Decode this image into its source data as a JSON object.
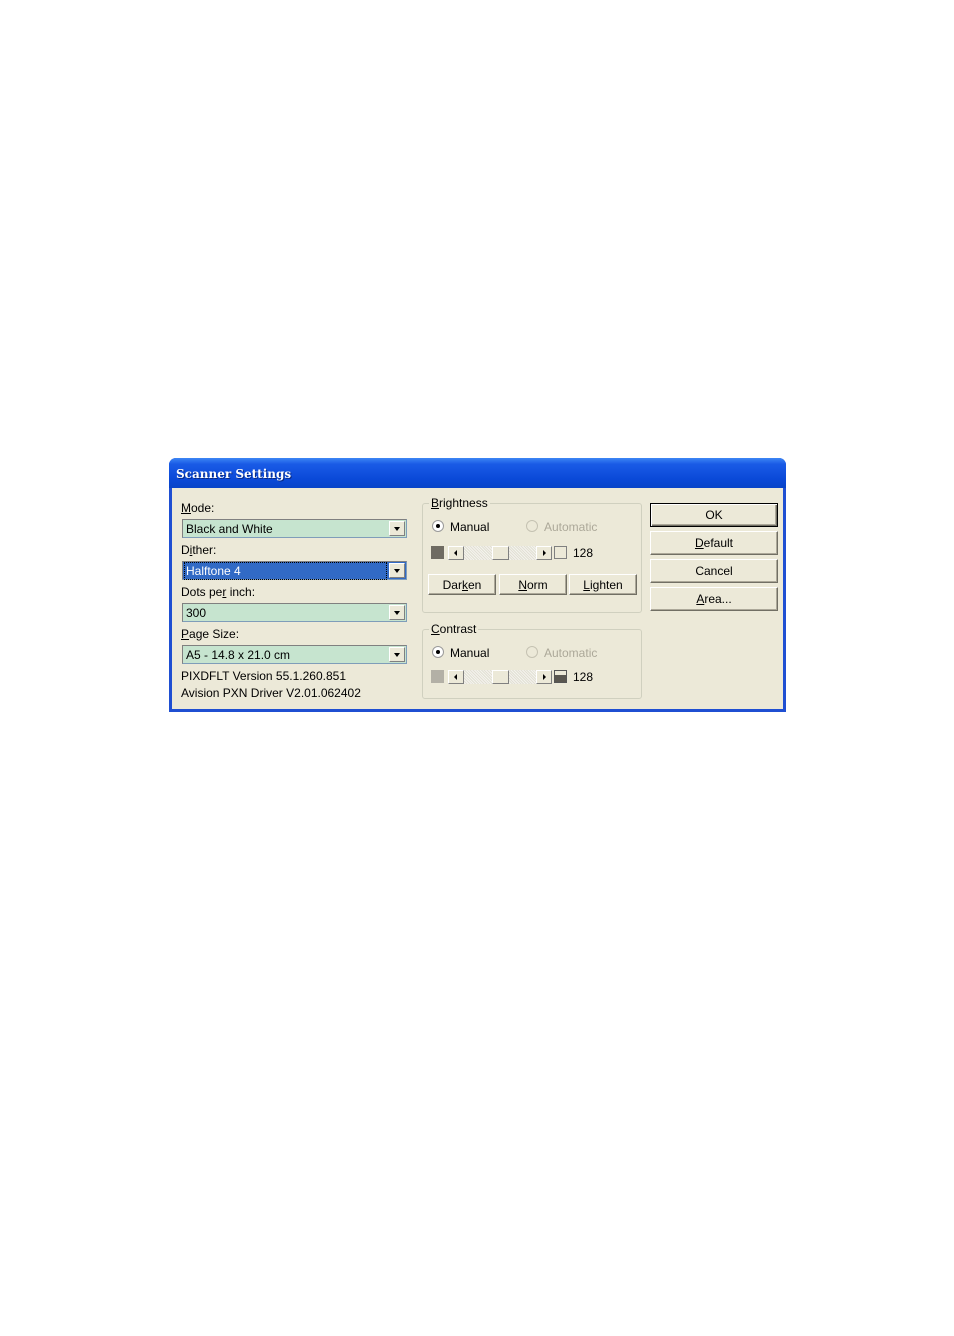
{
  "window": {
    "title": "Scanner Settings",
    "titlebar_color": "#0a49d8"
  },
  "left": {
    "mode": {
      "label_u": "M",
      "label_rest": "ode:",
      "value": "Black and White"
    },
    "dither": {
      "label_pre": "D",
      "label_u": "i",
      "label_rest": "ther:",
      "value": "Halftone 4"
    },
    "dpi": {
      "label_pre": "Dots pe",
      "label_u": "r",
      "label_rest": " inch:",
      "value": "300"
    },
    "page_size": {
      "label_u": "P",
      "label_rest": "age Size:",
      "value": "A5 - 14.8 x 21.0 cm"
    },
    "version_line": "PIXDFLT Version 55.1.260.851",
    "driver_line": "Avision PXN Driver V2.01.062402",
    "combo_color": "#c6e4cf",
    "selected_color": "#316ac5"
  },
  "brightness": {
    "label_u": "B",
    "label_rest": "rightness",
    "manual_label": "Manual",
    "automatic_label": "Automatic",
    "mode_selected": "Manual",
    "value": "128",
    "slider_fraction": 0.5,
    "buttons": {
      "darken": {
        "pre": "Dar",
        "u": "k",
        "post": "en"
      },
      "norm": {
        "pre": "",
        "u": "N",
        "post": "orm"
      },
      "lighten": {
        "pre": "",
        "u": "L",
        "post": "ighten"
      }
    }
  },
  "contrast": {
    "label_u": "C",
    "label_rest": "ontrast",
    "manual_label": "Manual",
    "automatic_label": "Automatic",
    "mode_selected": "Manual",
    "value": "128",
    "slider_fraction": 0.5
  },
  "actions": {
    "ok": {
      "pre": "OK",
      "u": "",
      "post": ""
    },
    "default": {
      "pre": "",
      "u": "D",
      "post": "efault"
    },
    "cancel": {
      "pre": "Cancel",
      "u": "",
      "post": ""
    },
    "area": {
      "pre": "",
      "u": "A",
      "post": "rea..."
    }
  }
}
